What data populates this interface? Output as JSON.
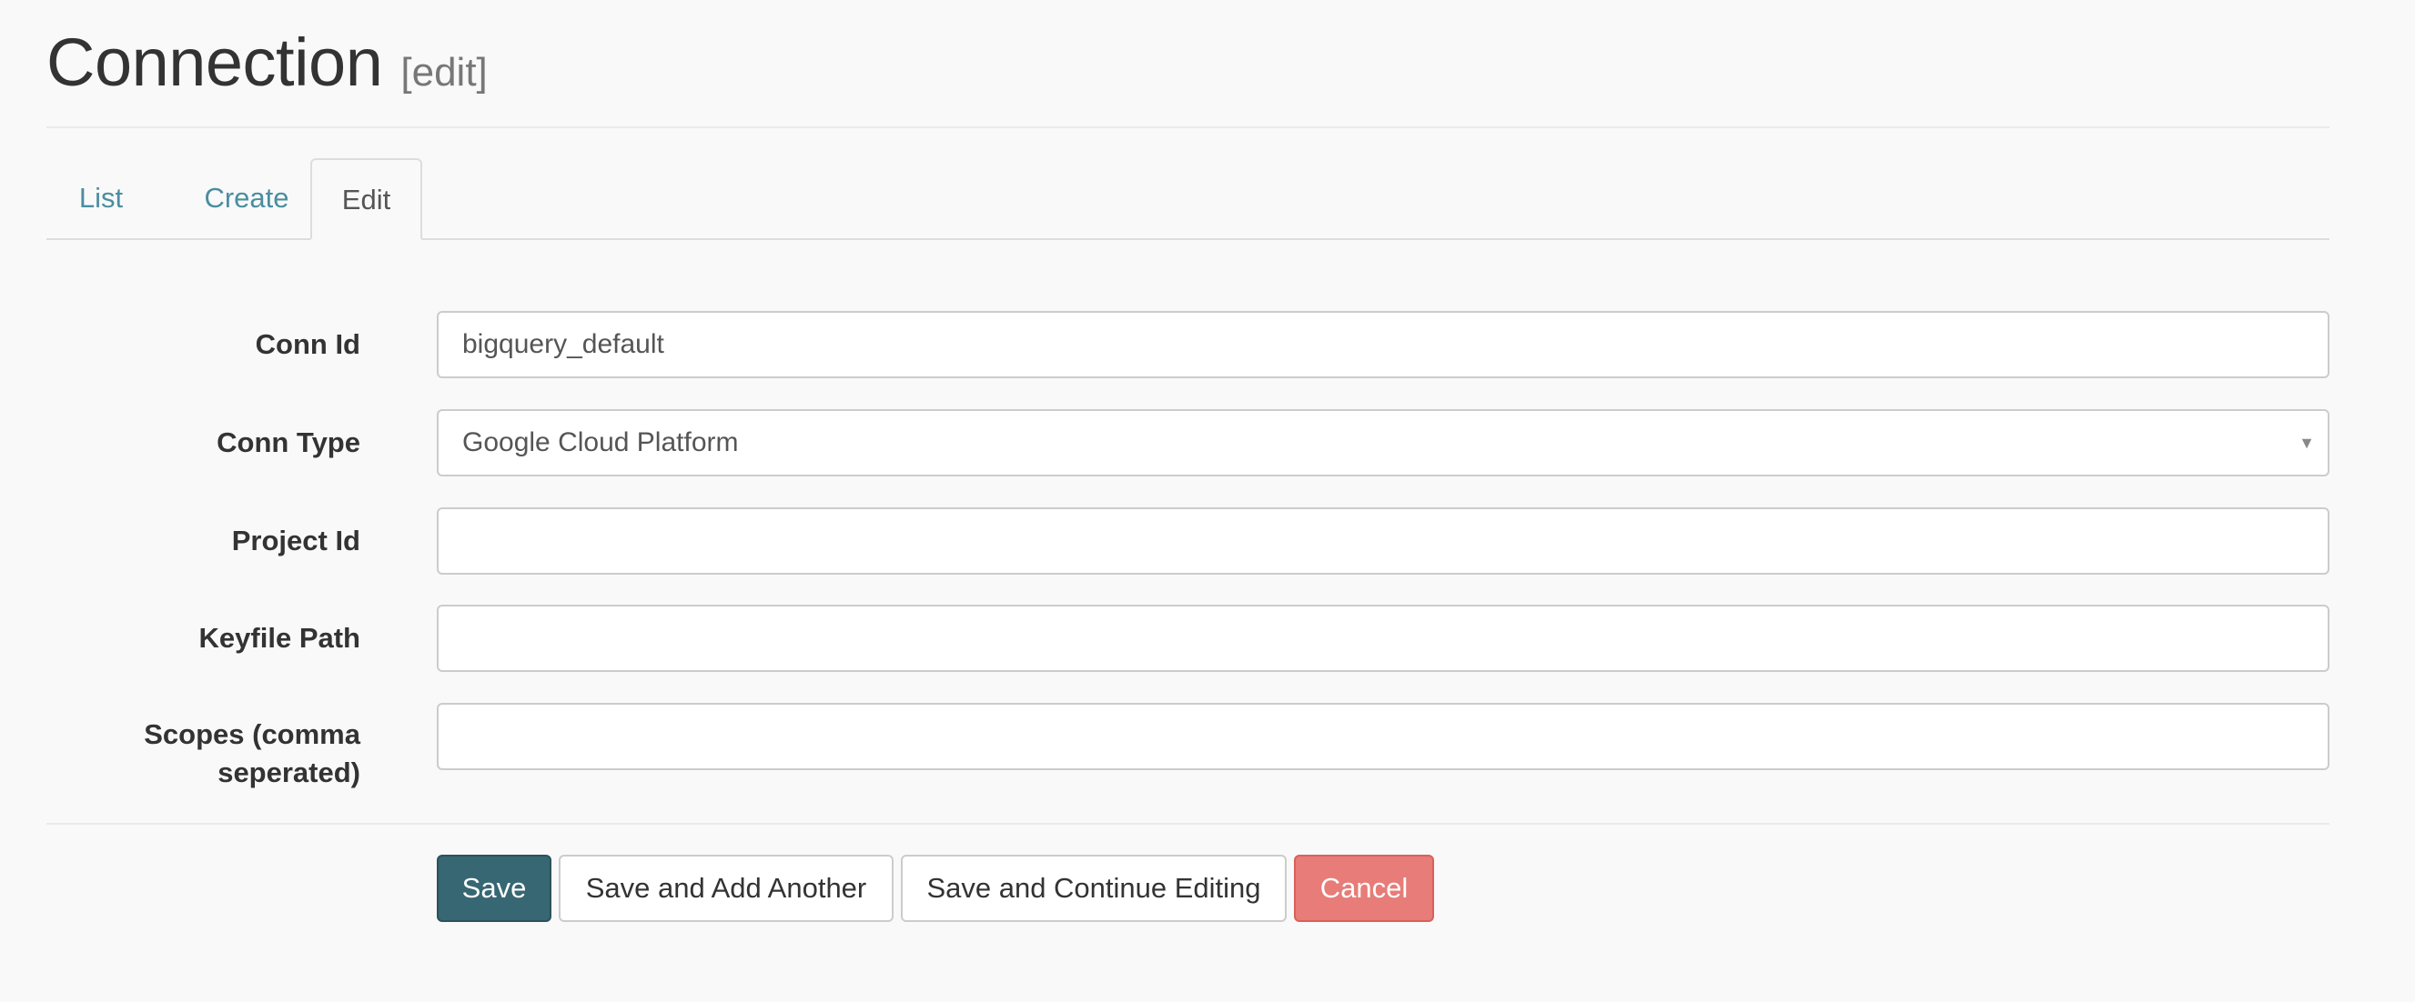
{
  "header": {
    "title": "Connection",
    "subtitle": "[edit]"
  },
  "tabs": [
    {
      "label": "List",
      "active": false
    },
    {
      "label": "Create",
      "active": false
    },
    {
      "label": "Edit",
      "active": true
    }
  ],
  "form": {
    "conn_id": {
      "label": "Conn Id",
      "value": "bigquery_default"
    },
    "conn_type": {
      "label": "Conn Type",
      "value": "Google Cloud Platform",
      "arrow": "▼"
    },
    "project_id": {
      "label": "Project Id",
      "value": ""
    },
    "keyfile_path": {
      "label": "Keyfile Path",
      "value": ""
    },
    "scopes": {
      "label_line1": "Scopes (comma",
      "label_line2": "seperated)",
      "value": ""
    }
  },
  "buttons": {
    "save": "Save",
    "save_add": "Save and Add Another",
    "save_continue": "Save and Continue Editing",
    "cancel": "Cancel"
  },
  "colors": {
    "primary": "#376772",
    "danger": "#e77c78",
    "link": "#4a8ea0",
    "background": "#f9f9f9"
  }
}
